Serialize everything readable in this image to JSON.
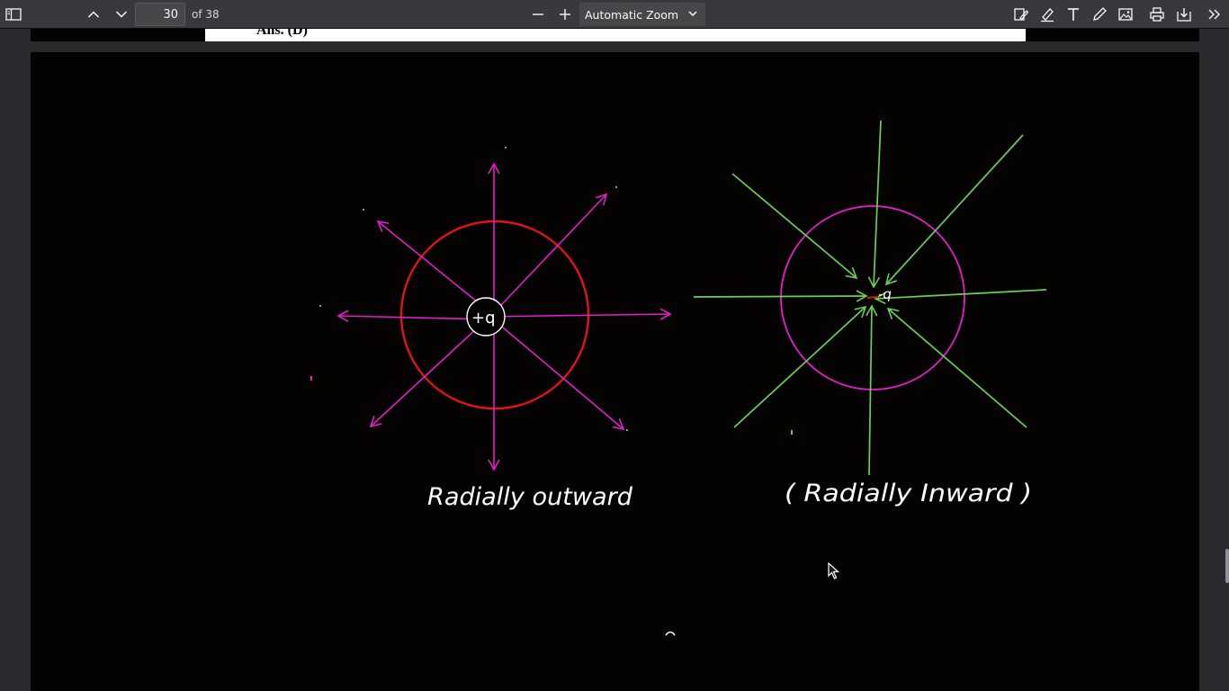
{
  "toolbar": {
    "page_number": "30",
    "page_count": "of 38",
    "zoom_label": "Automatic Zoom",
    "icons": [
      "sidebar-toggle-icon",
      "chevron-up-icon",
      "chevron-down-icon",
      "zoom-out-icon",
      "zoom-in-icon",
      "highlight-icon",
      "draw-icon",
      "text-icon",
      "signature-icon",
      "image-icon",
      "print-icon",
      "download-icon",
      "more-tools-icon"
    ]
  },
  "previous_page": {
    "answer_text": "Ans. (D)"
  },
  "drawing": {
    "left_label": "Radially outward",
    "left_charge_label": "+q",
    "right_label": "( Radially Inward )",
    "right_charge_label": "-q",
    "colors": {
      "board": "#050202",
      "outward_circle": "#e01515",
      "outward_arrows": "#e020c8",
      "inward_circle": "#e020c8",
      "inward_arrows": "#6ccf55",
      "ink": "#ffffff"
    }
  }
}
